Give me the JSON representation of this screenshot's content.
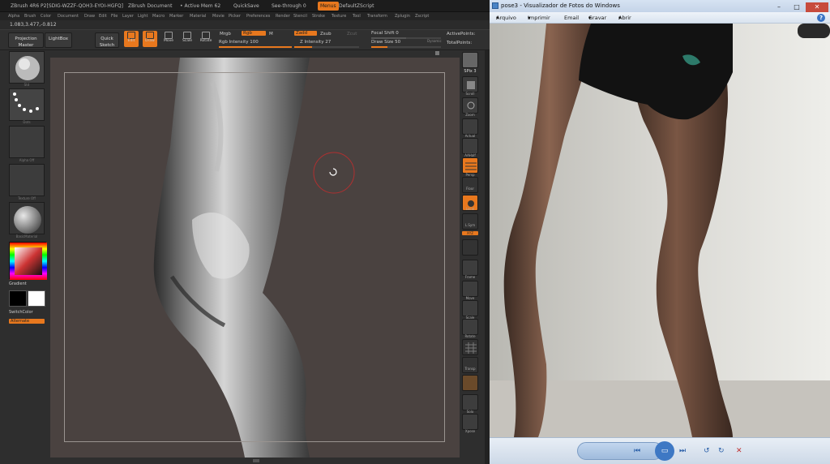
{
  "zbrush": {
    "title_parts": [
      "ZBrush 4R6 P2[SDIG-WZZF-QOH3-EYOI-HGFQ]",
      "ZBrush Document",
      "• Active Mem 62",
      "QuickSave",
      "See-through 0",
      "Menus",
      "DefaultZScript"
    ],
    "menus": [
      "Alpha",
      "Brush",
      "Color",
      "Document",
      "Draw",
      "Edit",
      "File",
      "Layer",
      "Light",
      "Macro",
      "Marker",
      "Material",
      "Movie",
      "Picker",
      "Preferences",
      "Render",
      "Stencil",
      "Stroke",
      "Texture",
      "Tool",
      "Transform",
      "Zplugin",
      "Zscript"
    ],
    "coords": "1.083,3.477,-0.812",
    "shelf": {
      "projection_master": "Projection Master",
      "lightbox": "LightBox",
      "quick_sketch": "Quick Sketch",
      "tools": [
        "Edit",
        "Draw",
        "Move",
        "Scale",
        "Rotate"
      ],
      "mrgb": "Mrgb",
      "rgb": "Rgb",
      "m": "M",
      "zadd": "Zadd",
      "zsub": "Zsub",
      "zcut": "Zcut",
      "rgb_intensity": "Rgb Intensity 100",
      "z_intensity": "Z Intensity 27",
      "focal_shift": "Focal Shift 0",
      "draw_size": "Draw Size 50",
      "dynamic": "Dynamic",
      "active_points": "ActivePoints:",
      "total_points": "TotalPoints:"
    },
    "left_thumbs": [
      "Std",
      "Dots",
      "Alpha Off",
      "Texture Off",
      "BasicMaterial"
    ],
    "gradient": "Gradient",
    "switch_color": "SwitchColor",
    "alternate": "Alternate",
    "right_buttons": [
      "SPix 3",
      "Scroll",
      "Zoom",
      "Actual",
      "AAHalf",
      "Persp",
      "Floor",
      "Local",
      "L.Sym",
      "Move",
      "Frame",
      "Move",
      "Scale",
      "Rotate",
      "Transp",
      "Ghost",
      "Solo",
      "Xpose"
    ],
    "right_xyz": "XYZ",
    "colors": {
      "accent": "#e8781e",
      "canvas": "#4a4240",
      "panel": "#2e2e2e"
    }
  },
  "viewer": {
    "title": "pose3 - Visualizador de Fotos do Windows",
    "menus": [
      "Arquivo",
      "Imprimir",
      "Email",
      "Gravar",
      "Abrir"
    ],
    "help": "?",
    "window_buttons": [
      "–",
      "□",
      "✕"
    ],
    "toolbar_icons": [
      "zoom-icon",
      "actual-size-icon",
      "previous-icon",
      "slideshow-icon",
      "next-icon",
      "rotate-left-icon",
      "rotate-right-icon",
      "delete-icon"
    ]
  }
}
